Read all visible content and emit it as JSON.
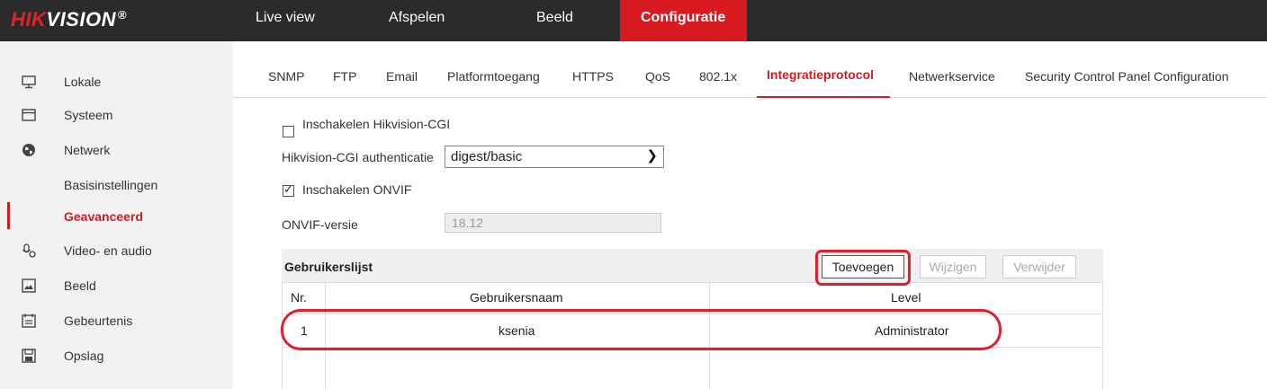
{
  "brand": {
    "prefix": "HIK",
    "suffix": "VISION",
    "reg": "®"
  },
  "nav": [
    "Live view",
    "Afspelen",
    "Beeld",
    "Configuratie"
  ],
  "sidebar": {
    "items": [
      {
        "label": "Lokale",
        "icon": "monitor-icon"
      },
      {
        "label": "Systeem",
        "icon": "window-icon"
      },
      {
        "label": "Netwerk",
        "icon": "globe-icon"
      },
      {
        "label": "Basisinstellingen"
      },
      {
        "label": "Geavanceerd"
      },
      {
        "label": "Video- en audio",
        "icon": "microphone-icon"
      },
      {
        "label": "Beeld",
        "icon": "image-icon"
      },
      {
        "label": "Gebeurtenis",
        "icon": "calendar-icon"
      },
      {
        "label": "Opslag",
        "icon": "floppy-disk-icon"
      }
    ]
  },
  "tabs": [
    "SNMP",
    "FTP",
    "Email",
    "Platformtoegang",
    "HTTPS",
    "QoS",
    "802.1x",
    "Integratieprotocol",
    "Netwerkservice",
    "Security Control Panel Configuration"
  ],
  "form": {
    "enable_cgi": {
      "label": "Inschakelen Hikvision-CGI",
      "checked": false
    },
    "cgi_auth": {
      "label": "Hikvision-CGI authenticatie",
      "value": "digest/basic"
    },
    "enable_onvif": {
      "label": "Inschakelen ONVIF",
      "checked": true
    },
    "onvif_version": {
      "label": "ONVIF-versie",
      "value": "18.12"
    }
  },
  "userlist": {
    "title": "Gebruikerslijst",
    "buttons": {
      "add": "Toevoegen",
      "edit": "Wijzigen",
      "delete": "Verwijder"
    },
    "columns": [
      "Nr.",
      "Gebruikersnaam",
      "Level"
    ],
    "rows": [
      {
        "nr": "1",
        "username": "ksenia",
        "level": "Administrator"
      }
    ]
  },
  "colors": {
    "accent": "#d71920",
    "topbar": "#2b2b2b",
    "sidebar": "#f2f2f2",
    "annotation": "#e0202a"
  }
}
